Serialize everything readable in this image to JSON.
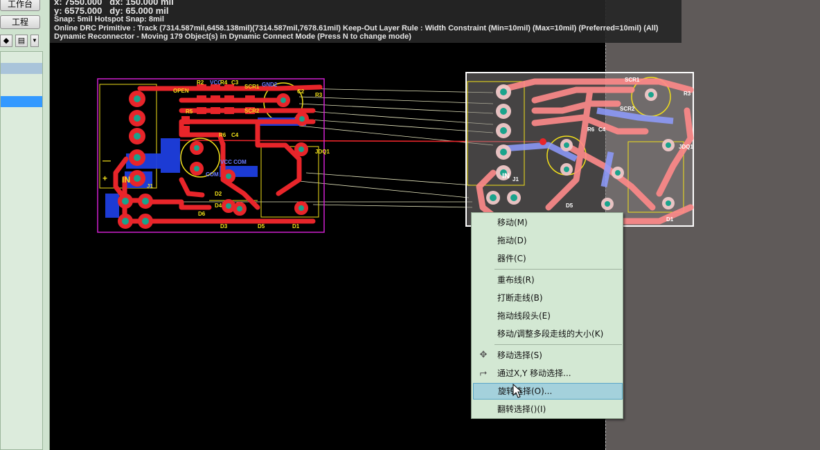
{
  "left_panel": {
    "workspace_button": "工作台",
    "project_button": "工程"
  },
  "hud": {
    "line1_x": "x:  7550.000",
    "line1_dx": "dx:  150.000  mil",
    "line2_y": "y:  6575.000",
    "line2_dy": "dy:  65.000  mil",
    "snap": "Snap: 5mil Hotspot Snap: 8mil",
    "drc": "Online DRC Primitive : Track (7314.587mil,6458.138mil)(7314.587mil,7678.61mil)  Keep-Out Layer Rule : Width Constraint (Min=10mil) (Max=10mil) (Preferred=10mil) (All)",
    "reconnector": "Dynamic Reconnector - Moving 179 Object(s) in Dynamic Connect Mode (Press N to change mode)"
  },
  "pcb_labels": {
    "open": "OPEN",
    "r2": "R2",
    "vcc": "VCC",
    "r4": "R4",
    "c3": "C3",
    "scr1": "SCR1",
    "gnd2": "GND2",
    "scr2": "SCR2",
    "c2": "C2",
    "r3": "R3",
    "c4": "C4",
    "r6": "R6",
    "r5": "R5",
    "jdq1": "JDQ1",
    "in": "IN",
    "j1": "J1",
    "d1": "D1",
    "d2": "D2",
    "d3": "D3",
    "d4": "D4",
    "d5": "D5",
    "d6": "D6",
    "com": "COM",
    "vcc_com": "VCC COM",
    "plus": "+",
    "minus": "—"
  },
  "menu": {
    "items": [
      {
        "label": "移动(M)",
        "icon": ""
      },
      {
        "label": "拖动(D)",
        "icon": ""
      },
      {
        "label": "器件(C)",
        "icon": ""
      },
      {
        "label": "重布线(R)",
        "icon": ""
      },
      {
        "label": "打断走线(B)",
        "icon": ""
      },
      {
        "label": "拖动线段头(E)",
        "icon": ""
      },
      {
        "label": "移动/调整多段走线的大小(K)",
        "icon": ""
      },
      {
        "label": "移动选择(S)",
        "icon": "move-cross-icon"
      },
      {
        "label": "通过X,Y 移动选择...",
        "icon": "xy-move-icon"
      },
      {
        "label": "旋转选择(O)...",
        "icon": ""
      },
      {
        "label": "翻转选择()(I)",
        "icon": ""
      }
    ],
    "highlighted_index": 9
  },
  "colors": {
    "board_outline_left": "#d020d0",
    "board_outline_right": "#ffffff",
    "top_copper": "#e8252a",
    "bottom_copper": "#1e3fe0",
    "silkscreen": "#f2e01a",
    "pad": "#1aa38c",
    "ratsnest": "#e8e8c0",
    "menu_bg": "#d3e8d3",
    "menu_highlight": "#a4d1dc"
  }
}
